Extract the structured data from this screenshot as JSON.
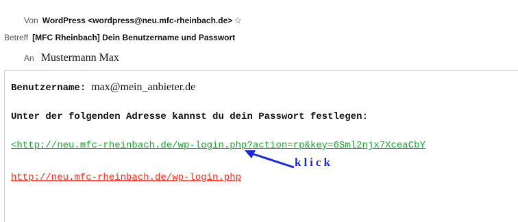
{
  "header": {
    "from_label": "Von",
    "from_value": "WordPress <wordpress@neu.mfc-rheinbach.de>",
    "subject_label": "Betreff",
    "subject_value": "[MFC Rheinbach] Dein Benutzername und Passwort",
    "to_label": "An",
    "to_value": "Mustermann Max"
  },
  "body": {
    "username_label": "Benutzername:",
    "username_value": "max@mein_anbieter.de",
    "instruction": "Unter der folgenden Adresse kannst du dein Passwort festlegen:",
    "reset_link": "<http://neu.mfc-rheinbach.de/wp-login.php?action=rp&key=6Sml2njx7XceaCbY",
    "login_link": "http://neu.mfc-rheinbach.de/wp-login.php"
  },
  "annotation": {
    "text": "klick",
    "color": "#1a2ad8"
  },
  "icons": {
    "star": "star-outline-icon"
  }
}
